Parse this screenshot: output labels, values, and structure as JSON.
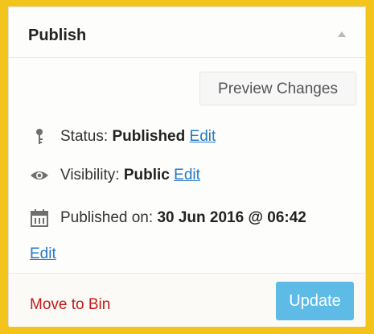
{
  "panel": {
    "title": "Publish",
    "preview_label": "Preview Changes",
    "status_label": "Status:",
    "status_value": "Published",
    "visibility_label": "Visibility:",
    "visibility_value": "Public",
    "published_label": "Published on:",
    "published_value": "30 Jun 2016 @ 06:42",
    "edit_label": "Edit",
    "trash_label": "Move to Bin",
    "update_label": "Update"
  },
  "icons": {
    "collapse": "caret-up-icon",
    "status": "key-icon",
    "visibility": "eye-icon",
    "published": "calendar-icon"
  },
  "colors": {
    "accent": "#f2c41c",
    "link": "#2479c7",
    "trash": "#c11a1a",
    "update_button": "#5dbbe6"
  }
}
